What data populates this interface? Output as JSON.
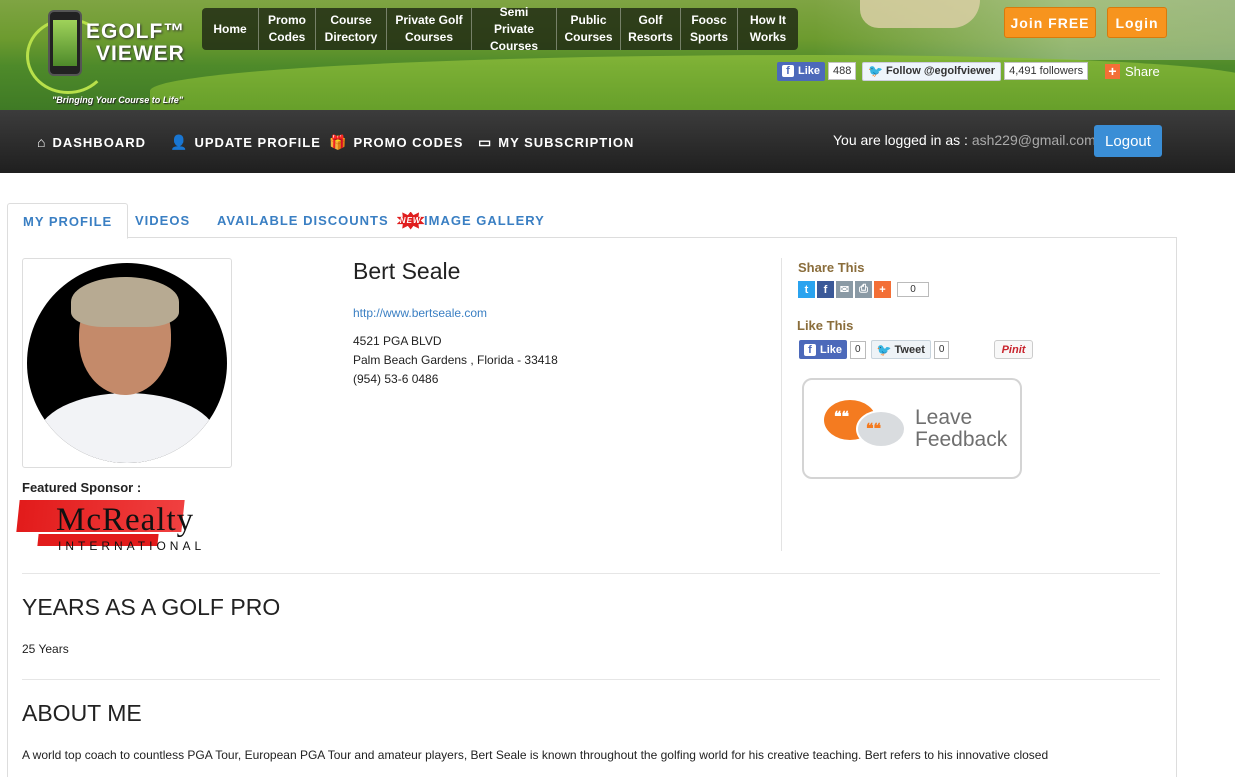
{
  "brand": {
    "line1": "EGOLF™",
    "line2": "VIEWER",
    "tagline": "\"Bringing Your Course to Life\""
  },
  "topnav": [
    {
      "l1": "Home",
      "l2": ""
    },
    {
      "l1": "Promo",
      "l2": "Codes"
    },
    {
      "l1": "Course",
      "l2": "Directory"
    },
    {
      "l1": "Private Golf",
      "l2": "Courses"
    },
    {
      "l1": "Semi Private",
      "l2": "Courses"
    },
    {
      "l1": "Public",
      "l2": "Courses"
    },
    {
      "l1": "Golf",
      "l2": "Resorts"
    },
    {
      "l1": "Foosc",
      "l2": "Sports"
    },
    {
      "l1": "How It",
      "l2": "Works"
    }
  ],
  "header_buttons": {
    "join": "Join FREE",
    "login": "Login"
  },
  "social_header": {
    "like_label": "Like",
    "like_count": "488",
    "follow_label": "Follow @egolfviewer",
    "followers": "4,491 followers",
    "share_label": "Share"
  },
  "dashnav": {
    "dashboard": "DASHBOARD",
    "update_profile": "UPDATE PROFILE",
    "promo_codes": "PROMO CODES",
    "subscription": "MY SUBSCRIPTION",
    "logged_in_label": "You are logged in as : ",
    "email": "ash229@gmail.com",
    "logout": "Logout"
  },
  "tabs": {
    "my_profile": "MY PROFILE",
    "videos": "VIDEOS",
    "discounts": "AVAILABLE DISCOUNTS",
    "new_badge": "NEW",
    "gallery": "IMAGE GALLERY"
  },
  "profile": {
    "name": "Bert Seale",
    "website": "http://www.bertseale.com",
    "address1": "4521 PGA BLVD",
    "address2": "Palm Beach Gardens , Florida - 33418",
    "phone": "(954) 53-6 0486",
    "featured_sponsor_label": "Featured Sponsor :",
    "sponsor_name": "McRealty",
    "sponsor_sub": "INTERNATIONAL"
  },
  "share_box": {
    "share_title": "Share This",
    "share_count": "0",
    "like_title": "Like This",
    "like_label": "Like",
    "like_count": "0",
    "tweet_label": "Tweet",
    "tweet_count": "0",
    "pinit_label": "Pinit",
    "feedback_line1": "Leave",
    "feedback_line2": "Feedback"
  },
  "sections": {
    "years_title": "YEARS AS A GOLF PRO",
    "years_value": "25 Years",
    "about_title": "ABOUT ME",
    "about_text": "A world top coach to countless PGA Tour, European PGA Tour and amateur players, Bert Seale is known throughout the golfing world for his creative teaching. Bert refers to his innovative closed"
  },
  "colors": {
    "accent_orange": "#f7941e",
    "link_blue": "#3a7fc3",
    "logout_blue": "#3a8ed6",
    "nav_dark": "#2a2a2a"
  }
}
